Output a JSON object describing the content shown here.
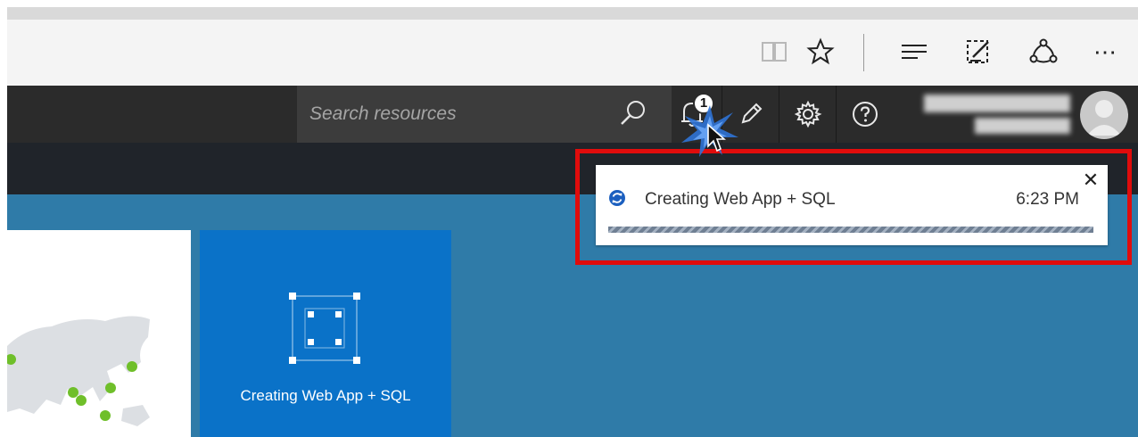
{
  "browser_toolbar": {
    "icons": [
      "reading-view-icon",
      "favorite-star-icon",
      "hub-icon",
      "web-note-icon",
      "share-icon",
      "more-icon"
    ],
    "more_label": "⋯"
  },
  "header": {
    "search": {
      "placeholder": "Search resources"
    },
    "notifications": {
      "badge_count": "1"
    },
    "icons": [
      "search-icon",
      "bell-icon",
      "pencil-icon",
      "gear-icon",
      "help-icon",
      "avatar"
    ]
  },
  "dashboard": {
    "tile": {
      "label": "Creating Web App + SQL"
    }
  },
  "notification": {
    "title": "Creating Web App + SQL",
    "time": "6:23 PM",
    "close_label": "✕",
    "status": "in-progress",
    "colors": {
      "highlight": "#e00c0c",
      "progress": "#6f7f93",
      "icon": "#1b5fbf"
    }
  },
  "colors": {
    "header_bg": "#2b2b2b",
    "dashboard_bg": "#2f7ba8",
    "tile_bg": "#0a72c8",
    "map_check": "#6fbf2a"
  }
}
